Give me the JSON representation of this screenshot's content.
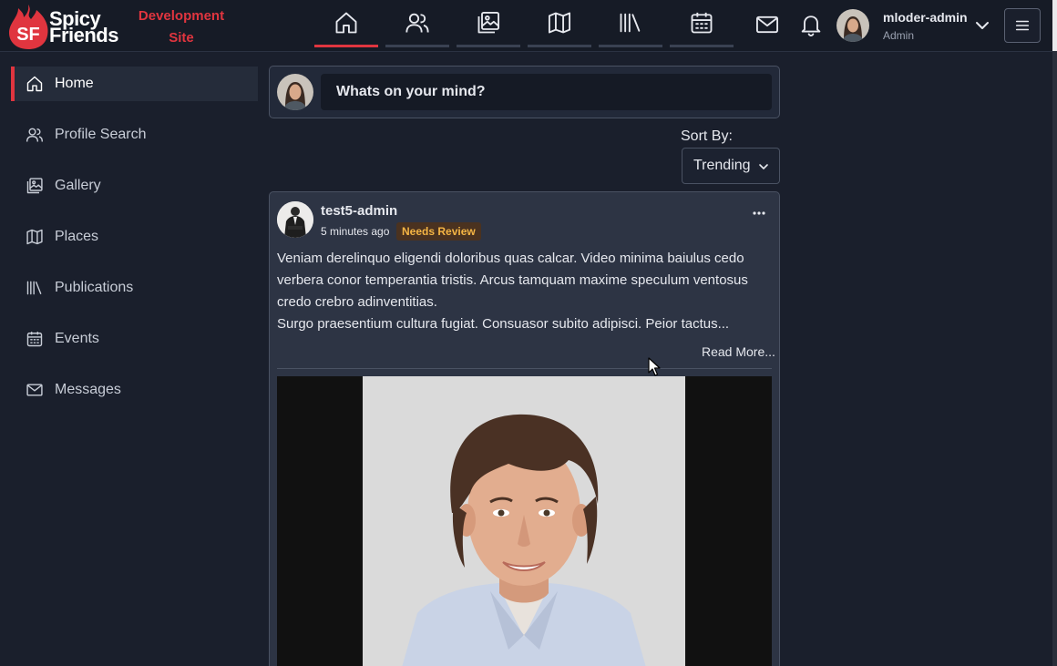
{
  "header": {
    "logo_line1": "Spicy",
    "logo_line2": "Friends",
    "logo_mark_text": "SF",
    "site_label": "Development Site",
    "nav_tabs": [
      {
        "icon": "home-icon",
        "active": true
      },
      {
        "icon": "users-icon",
        "active": false
      },
      {
        "icon": "gallery-icon",
        "active": false
      },
      {
        "icon": "map-icon",
        "active": false
      },
      {
        "icon": "library-icon",
        "active": false
      },
      {
        "icon": "calendar-icon",
        "active": false
      }
    ],
    "user": {
      "name": "mloder-admin",
      "role": "Admin"
    }
  },
  "sidebar": {
    "items": [
      {
        "label": "Home",
        "icon": "home-icon",
        "active": true
      },
      {
        "label": "Profile Search",
        "icon": "users-icon",
        "active": false
      },
      {
        "label": "Gallery",
        "icon": "gallery-icon",
        "active": false
      },
      {
        "label": "Places",
        "icon": "map-icon",
        "active": false
      },
      {
        "label": "Publications",
        "icon": "library-icon",
        "active": false
      },
      {
        "label": "Events",
        "icon": "calendar-icon",
        "active": false
      },
      {
        "label": "Messages",
        "icon": "mail-icon",
        "active": false
      }
    ]
  },
  "composer": {
    "placeholder": "Whats on your mind?"
  },
  "sort": {
    "label": "Sort By:",
    "value": "Trending"
  },
  "post": {
    "author": "test5-admin",
    "time": "5 minutes ago",
    "badge": "Needs Review",
    "body_lines": [
      "Veniam derelinquo eligendi doloribus quas calcar. Video minima baiulus cedo verbera conor temperantia tristis. Arcus tamquam maxime speculum ventosus credo crebro adinventitias.",
      "Surgo praesentium cultura fugiat. Consuasor subito adipisci. Peior tactus..."
    ],
    "read_more": "Read More..."
  },
  "colors": {
    "accent": "#e0353f",
    "badge_text": "#f5b544",
    "background": "#1a1f2c",
    "card": "#2d3444"
  }
}
